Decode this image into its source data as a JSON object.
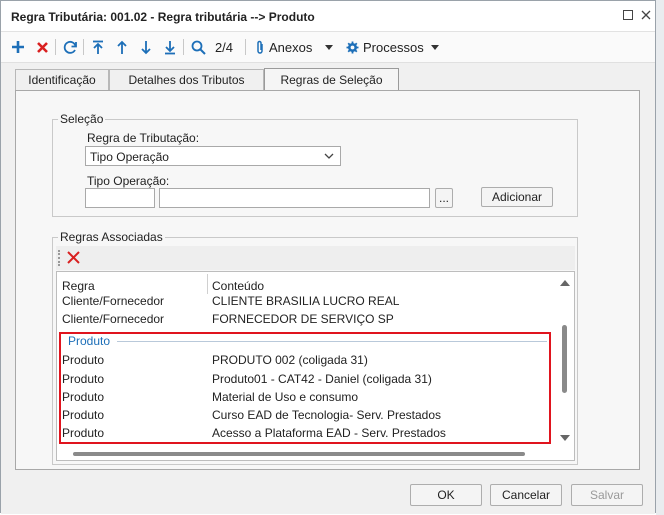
{
  "window": {
    "title": "Regra Tributária: 001.02 - Regra tributária --> Produto"
  },
  "toolbar": {
    "record_position": "2/4",
    "anexos_label": "Anexos",
    "processos_label": "Processos"
  },
  "tabs": [
    {
      "label": "Identificação"
    },
    {
      "label": "Detalhes dos Tributos"
    },
    {
      "label": "Regras de Seleção"
    }
  ],
  "selecao": {
    "title": "Seleção",
    "regra_label": "Regra de Tributação:",
    "regra_value": "Tipo Operação",
    "tipo_label": "Tipo Operação:",
    "lookup_button": "...",
    "add_button": "Adicionar"
  },
  "regras": {
    "title": "Regras Associadas",
    "columns": [
      "Regra",
      "Conteúdo"
    ],
    "rows": [
      {
        "regra": "Cliente/Fornecedor",
        "conteudo": "CLIENTE BRASILIA LUCRO REAL"
      },
      {
        "regra": "Cliente/Fornecedor",
        "conteudo": "FORNECEDOR DE SERVIÇO SP"
      }
    ],
    "group_label": "Produto",
    "group_rows": [
      {
        "regra": "Produto",
        "conteudo": "PRODUTO 002 (coligada 31)"
      },
      {
        "regra": "Produto",
        "conteudo": "Produto01 -  CAT42 - Daniel (coligada 31)"
      },
      {
        "regra": "Produto",
        "conteudo": "Material de Uso e consumo"
      },
      {
        "regra": "Produto",
        "conteudo": "Curso EAD de Tecnologia- Serv. Prestados"
      },
      {
        "regra": "Produto",
        "conteudo": "Acesso a Plataforma EAD - Serv. Prestados"
      }
    ]
  },
  "footer": {
    "ok": "OK",
    "cancel": "Cancelar",
    "save": "Salvar"
  },
  "colors": {
    "accent": "#1d6fb8",
    "delete": "#d92020",
    "highlight": "#e0141e"
  }
}
